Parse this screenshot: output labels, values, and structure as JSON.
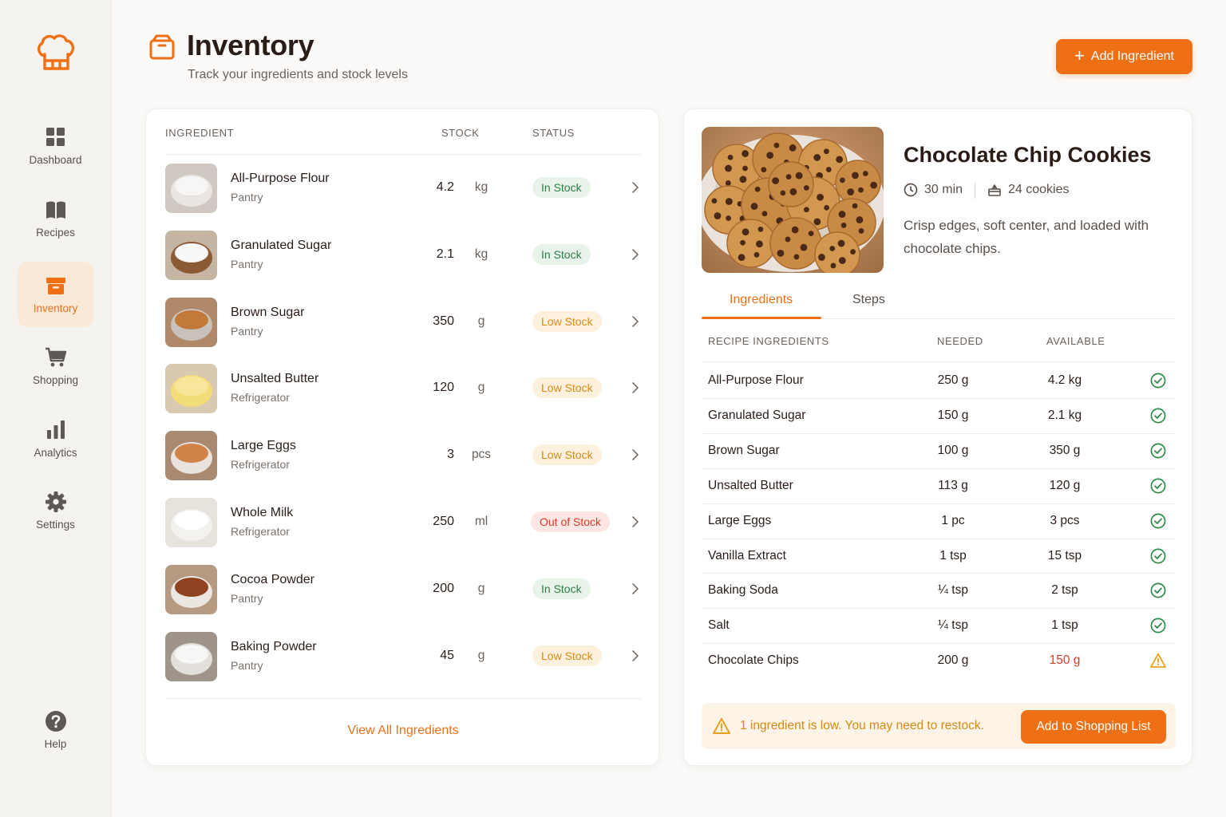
{
  "colors": {
    "accent": "#ef7014",
    "in_stock": "#2e7d45",
    "low_stock": "#d58a14",
    "out_of_stock": "#d93a2a"
  },
  "sidebar": {
    "logo_icon": "chef-hat-icon",
    "items": [
      {
        "label": "Dashboard",
        "icon": "grid-icon",
        "active": false
      },
      {
        "label": "Recipes",
        "icon": "book-icon",
        "active": false
      },
      {
        "label": "Inventory",
        "icon": "box-icon",
        "active": true
      },
      {
        "label": "Shopping",
        "icon": "cart-icon",
        "active": false
      },
      {
        "label": "Analytics",
        "icon": "bar-chart-icon",
        "active": false
      },
      {
        "label": "Settings",
        "icon": "gear-icon",
        "active": false
      }
    ],
    "help": {
      "label": "Help",
      "icon": "help-icon"
    }
  },
  "header": {
    "title": "Inventory",
    "subtitle": "Track your ingredients and stock levels",
    "add_button": "Add Ingredient"
  },
  "inventory": {
    "columns": {
      "ingredient": "INGREDIENT",
      "stock": "STOCK",
      "status": "STATUS"
    },
    "rows": [
      {
        "name": "All-Purpose Flour",
        "location": "Pantry",
        "qty": "4.2",
        "unit": "kg",
        "status": "In Stock",
        "status_key": "in"
      },
      {
        "name": "Granulated Sugar",
        "location": "Pantry",
        "qty": "2.1",
        "unit": "kg",
        "status": "In Stock",
        "status_key": "in"
      },
      {
        "name": "Brown Sugar",
        "location": "Pantry",
        "qty": "350",
        "unit": "g",
        "status": "Low Stock",
        "status_key": "low"
      },
      {
        "name": "Unsalted Butter",
        "location": "Refrigerator",
        "qty": "120",
        "unit": "g",
        "status": "Low Stock",
        "status_key": "low"
      },
      {
        "name": "Large Eggs",
        "location": "Refrigerator",
        "qty": "3",
        "unit": "pcs",
        "status": "Low Stock",
        "status_key": "low"
      },
      {
        "name": "Whole Milk",
        "location": "Refrigerator",
        "qty": "250",
        "unit": "ml",
        "status": "Out of Stock",
        "status_key": "out"
      },
      {
        "name": "Cocoa Powder",
        "location": "Pantry",
        "qty": "200",
        "unit": "g",
        "status": "In Stock",
        "status_key": "in"
      },
      {
        "name": "Baking Powder",
        "location": "Pantry",
        "qty": "45",
        "unit": "g",
        "status": "Low Stock",
        "status_key": "low"
      }
    ],
    "view_all": "View All Ingredients"
  },
  "recipe": {
    "title": "Chocolate Chip Cookies",
    "time": "30 min",
    "yield": "24 cookies",
    "description": "Crisp edges, soft center, and loaded with chocolate chips.",
    "tabs": [
      "Ingredients",
      "Steps"
    ],
    "columns": {
      "name": "RECIPE INGREDIENTS",
      "needed": "NEEDED",
      "available": "AVAILABLE"
    },
    "rows": [
      {
        "name": "All-Purpose Flour",
        "needed": "250 g",
        "available": "4.2 kg",
        "ok": true
      },
      {
        "name": "Granulated Sugar",
        "needed": "150 g",
        "available": "2.1 kg",
        "ok": true
      },
      {
        "name": "Brown Sugar",
        "needed": "100 g",
        "available": "350 g",
        "ok": true
      },
      {
        "name": "Unsalted Butter",
        "needed": "113 g",
        "available": "120 g",
        "ok": true
      },
      {
        "name": "Large Eggs",
        "needed": "1 pc",
        "available": "3 pcs",
        "ok": true
      },
      {
        "name": "Vanilla Extract",
        "needed": "1 tsp",
        "available": "15 tsp",
        "ok": true
      },
      {
        "name": "Baking Soda",
        "needed": "¼ tsp",
        "available": "2 tsp",
        "ok": true
      },
      {
        "name": "Salt",
        "needed": "¼ tsp",
        "available": "1 tsp",
        "ok": true
      },
      {
        "name": "Chocolate Chips",
        "needed": "200 g",
        "available": "150 g",
        "ok": false
      }
    ],
    "alert": "1 ingredient is low. You may need to restock.",
    "shopping_button": "Add to Shopping List"
  }
}
